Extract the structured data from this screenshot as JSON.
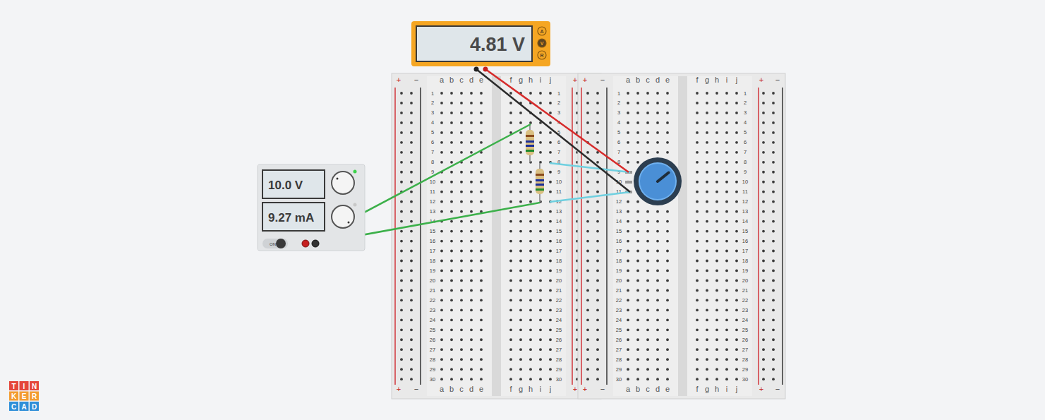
{
  "multimeter": {
    "reading": "4.81 V",
    "modes": [
      {
        "label": "A",
        "selected": false
      },
      {
        "label": "V",
        "selected": true
      },
      {
        "label": "R",
        "selected": false
      }
    ]
  },
  "power_supply": {
    "voltage": "10.0 V",
    "current": "9.27 mA",
    "switch_label": "ON",
    "on": true,
    "cv_lit": true
  },
  "breadboards": [
    {
      "left_columns": [
        "a",
        "b",
        "c",
        "d",
        "e"
      ],
      "right_columns": [
        "f",
        "g",
        "h",
        "i",
        "j"
      ],
      "rail_plus": "+",
      "rail_minus": "−"
    },
    {
      "left_columns": [
        "a",
        "b",
        "c",
        "d",
        "e"
      ],
      "right_columns": [
        "f",
        "g",
        "h",
        "i",
        "j"
      ],
      "rail_plus": "+",
      "rail_minus": "−"
    }
  ],
  "row_labels": [
    "1",
    "2",
    "3",
    "4",
    "5",
    "6",
    "7",
    "8",
    "9",
    "10",
    "11",
    "12",
    "13",
    "14",
    "15",
    "16",
    "17",
    "18",
    "19",
    "20",
    "21",
    "22",
    "23",
    "24",
    "25",
    "26",
    "27",
    "28",
    "29",
    "30"
  ],
  "potentiometer": {
    "level": 0.69
  },
  "logo": [
    "T",
    "I",
    "N",
    "K",
    "E",
    "R",
    "C",
    "A",
    "D"
  ]
}
